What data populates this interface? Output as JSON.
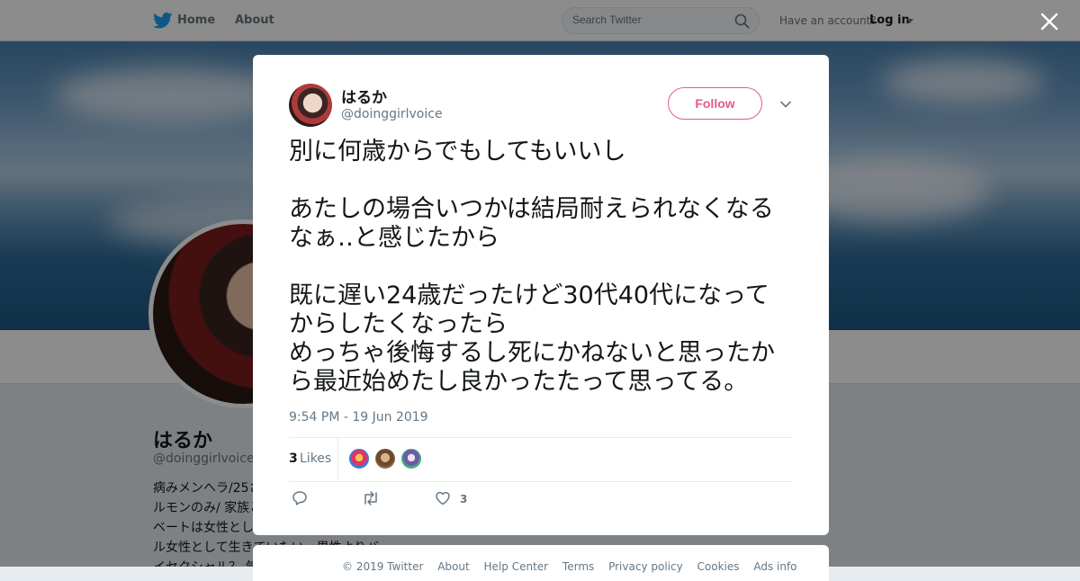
{
  "topbar": {
    "home_label": "Home",
    "about_label": "About",
    "search_placeholder": "Search Twitter",
    "have_account": "Have an account?",
    "login_label": "Log in",
    "brand_color": "#1da1f2"
  },
  "profile": {
    "name": "はるか",
    "handle": "@doinggirlvoice",
    "bio_visible": "病みメンヘラ/25さ\nルモンのみ/ 家族と\nベートは女性とし\nル女性として生きていたい。男性よりバ\nイセクシャル？ 気"
  },
  "tweet": {
    "author_name": "はるか",
    "author_handle": "@doinggirlvoice",
    "follow_label": "Follow",
    "text": "別に何歳からでもしてもいいし\n\nあたしの場合いつかは結局耐えられなくなるなぁ‥と感じたから\n\n既に遅い24歳だったけど30代40代になってからしたくなったら\nめっちゃ後悔するし死にかねないと思ったから最近始めたし良かったたって思ってる。",
    "timestamp": "9:54 PM - 19 Jun 2019",
    "likes_count": "3",
    "likes_label": "Likes",
    "like_action_count": "3",
    "accent_color": "#e0245e"
  },
  "footer": {
    "links": [
      "© 2019 Twitter",
      "About",
      "Help Center",
      "Terms",
      "Privacy policy",
      "Cookies",
      "Ads info"
    ]
  }
}
